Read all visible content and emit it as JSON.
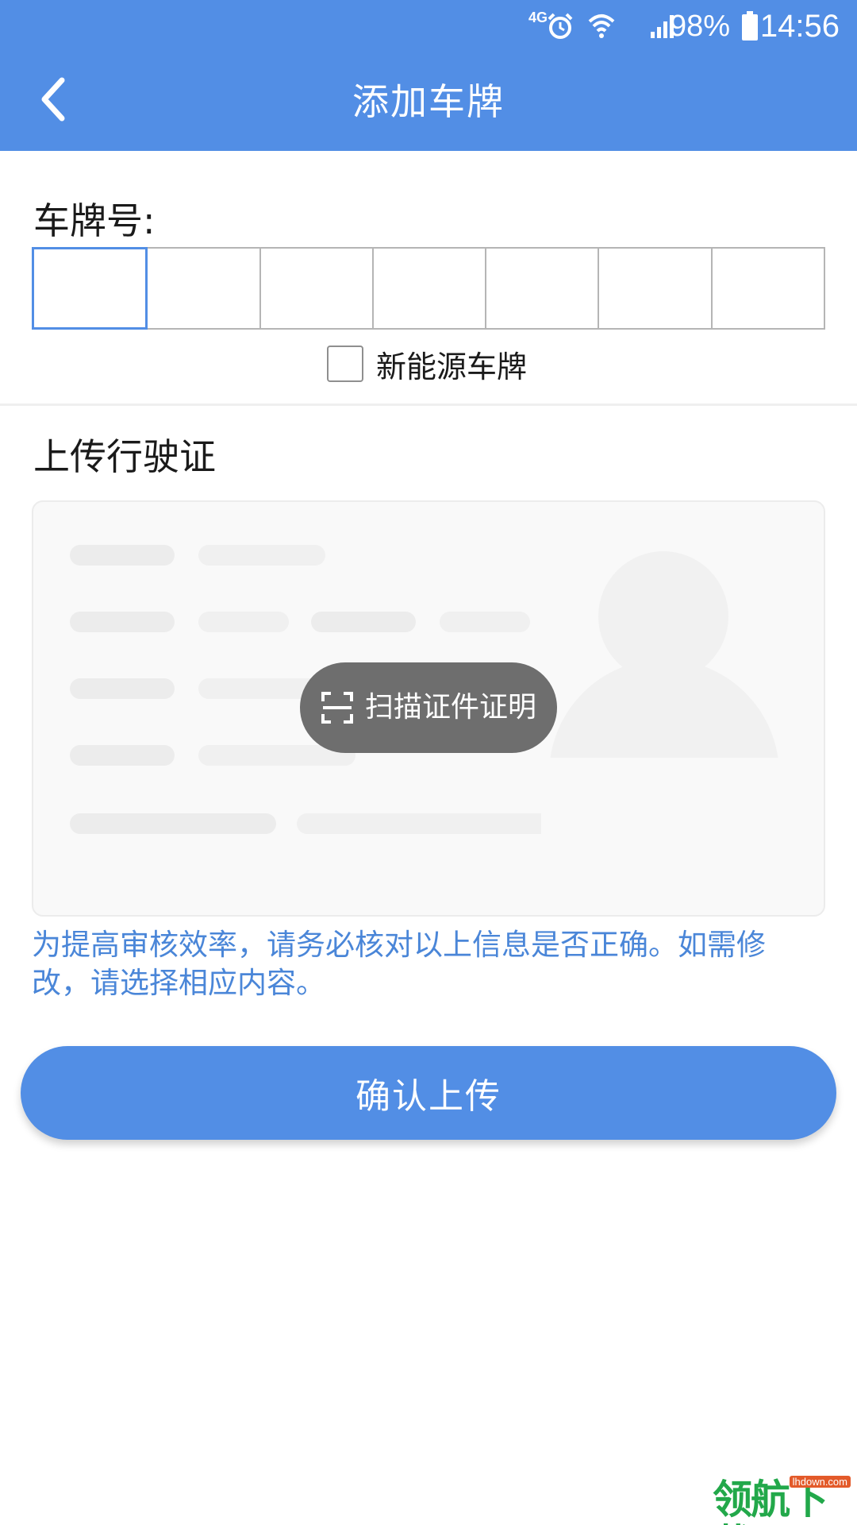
{
  "status_bar": {
    "network": "4G",
    "battery": "98%",
    "time": "14:56"
  },
  "header": {
    "title": "添加车牌",
    "back_icon": "chevron-left-icon"
  },
  "plate": {
    "label": "车牌号:",
    "cells": [
      "",
      "",
      "",
      "",
      "",
      "",
      ""
    ],
    "new_energy": {
      "label": "新能源车牌",
      "checked": false
    }
  },
  "upload": {
    "title": "上传行驶证",
    "scan_button": "扫描证件证明",
    "notice": "为提高审核效率，请务必核对以上信息是否正确。如需修改，请选择相应内容。"
  },
  "confirm_button": "确认上传",
  "watermark": {
    "main": "领航下载",
    "sub": "lhdown.com"
  },
  "colors": {
    "primary": "#528ee5",
    "notice_text": "#4a86d8",
    "scan_button_bg": "#6e6e6e",
    "watermark": "#22a84a"
  }
}
